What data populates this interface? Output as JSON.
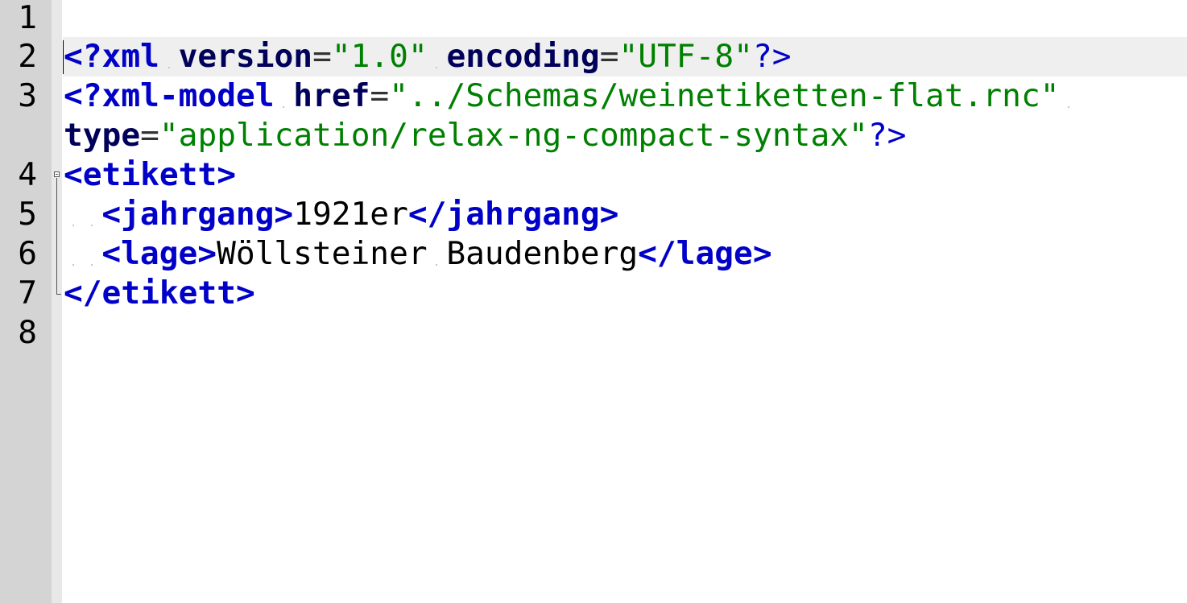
{
  "gutter": {
    "line_numbers": [
      "1",
      "2",
      "3",
      "",
      "4",
      "5",
      "6",
      "7",
      "8"
    ]
  },
  "editor": {
    "line2": {
      "pi_open": "<?xml",
      "attr1": "version",
      "eq1": "=",
      "val1": "\"1.0\"",
      "attr2": "encoding",
      "eq2": "=",
      "val2": "\"UTF-8\"",
      "pi_close": "?>"
    },
    "line3": {
      "pi_open": "<?xml-model",
      "attr1": "href",
      "eq1": "=",
      "val1": "\"../Schemas/weinetiketten-flat.rnc\""
    },
    "line3_wrap": {
      "attr2": "type",
      "eq2": "=",
      "val2": "\"application/relax-ng-compact-syntax\"",
      "pi_close": "?>"
    },
    "line4": {
      "open_tag": "<etikett>"
    },
    "line5": {
      "open_tag": "<jahrgang>",
      "text": "1921er",
      "close_tag": "</jahrgang>"
    },
    "line6": {
      "open_tag": "<lage>",
      "text_part1": "Wöllsteiner",
      "text_part2": "Baudenberg",
      "close_tag": "</lage>"
    },
    "line7": {
      "close_tag": "</etikett>"
    }
  },
  "colors": {
    "tag": "#0000c8",
    "attribute": "#00005a",
    "string": "#008000",
    "text": "#000000",
    "gutter_bg": "#d4d4d4",
    "current_line_bg": "#efefef"
  }
}
